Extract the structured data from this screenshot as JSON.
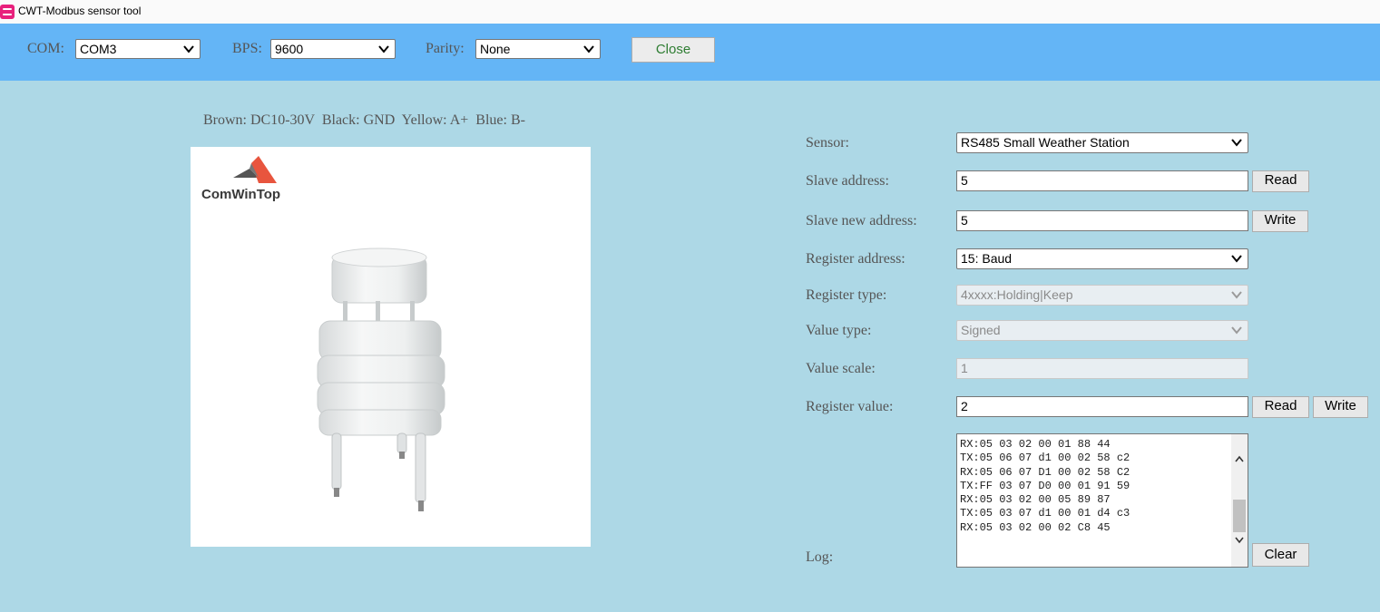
{
  "window": {
    "title": "CWT-Modbus sensor tool"
  },
  "toolbar": {
    "com_label": "COM:",
    "com_value": "COM3",
    "bps_label": "BPS:",
    "bps_value": "9600",
    "parity_label": "Parity:",
    "parity_value": "None",
    "close_button": "Close"
  },
  "wiring_text": "Brown: DC10-30V  Black: GND  Yellow: A+  Blue: B-",
  "brand": {
    "logo_text": "ComWinTop"
  },
  "form": {
    "sensor_label": "Sensor:",
    "sensor_value": "RS485 Small Weather Station",
    "slave_address_label": "Slave address:",
    "slave_address_value": "5",
    "slave_address_read": "Read",
    "slave_new_address_label": "Slave new address:",
    "slave_new_address_value": "5",
    "slave_new_address_write": "Write",
    "register_address_label": "Register address:",
    "register_address_value": "15: Baud",
    "register_type_label": "Register type:",
    "register_type_value": "4xxxx:Holding|Keep",
    "value_type_label": "Value type:",
    "value_type_value": "Signed",
    "value_scale_label": "Value scale:",
    "value_scale_value": "1",
    "register_value_label": "Register value:",
    "register_value_value": "2",
    "register_value_read": "Read",
    "register_value_write": "Write",
    "log_label": "Log:",
    "clear_button": "Clear"
  },
  "log": {
    "lines": [
      "RX:05 03 02 00 01 88 44",
      "TX:05 06 07 d1 00 02 58 c2",
      "RX:05 06 07 D1 00 02 58 C2",
      "TX:FF 03 07 D0 00 01 91 59",
      "RX:05 03 02 00 05 89 87",
      "TX:05 03 07 d1 00 01 d4 c3",
      "RX:05 03 02 00 02 C8 45"
    ]
  },
  "colors": {
    "background": "#add8e6",
    "toolbar": "#64b5f6",
    "app_icon": "#e8207c",
    "logo_accent": "#e8553e"
  },
  "icons": [
    "app-icon",
    "chevron-down-icon",
    "scroll-up-icon",
    "scroll-down-icon"
  ]
}
